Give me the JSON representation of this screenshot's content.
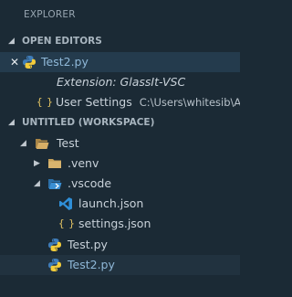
{
  "explorer_title": "EXPLORER",
  "open_editors": {
    "header": "OPEN EDITORS",
    "items": [
      {
        "label": "Test2.py",
        "icon": "python-icon"
      },
      {
        "label": "Extension: GlassIt-VSC",
        "icon": "none"
      },
      {
        "label": "User Settings",
        "description": "C:\\Users\\whitesib\\A...",
        "icon": "json-braces-icon"
      }
    ]
  },
  "workspace": {
    "header": "UNTITLED (WORKSPACE)",
    "tree": {
      "root": "Test",
      "venv": ".venv",
      "vscode": ".vscode",
      "launch": "launch.json",
      "settings": "settings.json",
      "test_py": "Test.py",
      "test2_py": "Test2.py"
    }
  },
  "colors": {
    "background": "#1b2a35",
    "selection": "#243b4d",
    "python_blue": "#3f7cb8",
    "python_yellow": "#f4cd3b",
    "folder": "#c8a25a",
    "vscode_blue": "#2f8fd8",
    "json_yellow": "#e4c463"
  }
}
